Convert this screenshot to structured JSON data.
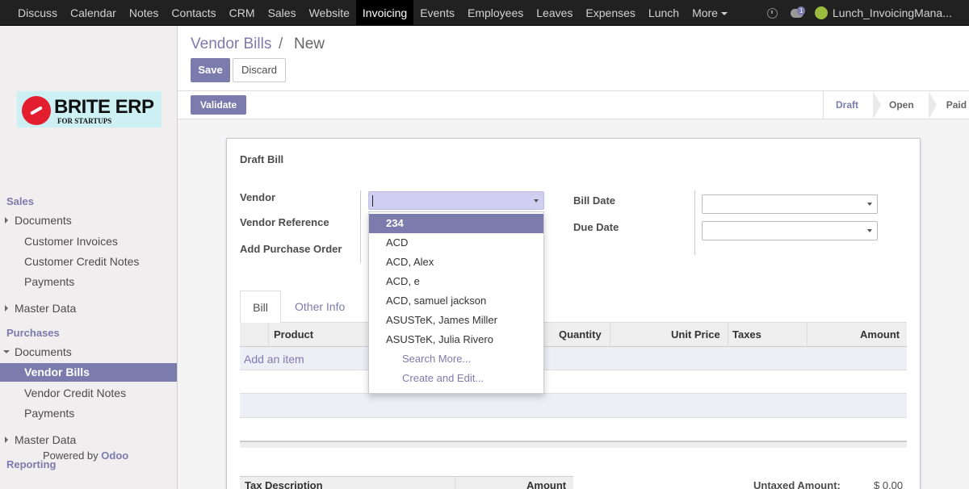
{
  "topmenu": {
    "items": [
      "Discuss",
      "Calendar",
      "Notes",
      "Contacts",
      "CRM",
      "Sales",
      "Website",
      "Invoicing",
      "Events",
      "Employees",
      "Leaves",
      "Expenses",
      "Lunch"
    ],
    "more_label": "More",
    "notification_count": "1",
    "user_name": "Lunch_InvoicingMana..."
  },
  "logo": {
    "name": "BRITE ERP",
    "tagline": "FOR STARTUPS"
  },
  "sidebar": {
    "sales_header": "Sales",
    "sales_documents": "Documents",
    "customer_invoices": "Customer Invoices",
    "customer_credit_notes": "Customer Credit Notes",
    "sales_payments": "Payments",
    "sales_master_data": "Master Data",
    "purchases_header": "Purchases",
    "purchases_documents": "Documents",
    "vendor_bills": "Vendor Bills",
    "vendor_credit_notes": "Vendor Credit Notes",
    "purchases_payments": "Payments",
    "purchases_master_data": "Master Data",
    "reporting_header": "Reporting",
    "powered_by": "Powered by",
    "powered_brand": "Odoo"
  },
  "breadcrumb": {
    "parent": "Vendor Bills",
    "separator": "/",
    "current": "New"
  },
  "buttons": {
    "save": "Save",
    "discard": "Discard",
    "validate": "Validate"
  },
  "status_stages": [
    "Draft",
    "Open",
    "Paid"
  ],
  "form": {
    "title": "Draft Bill",
    "vendor_label": "Vendor",
    "vendor_reference_label": "Vendor Reference",
    "add_purchase_order_label": "Add Purchase Order",
    "bill_date_label": "Bill Date",
    "due_date_label": "Due Date",
    "vendor_value": ""
  },
  "vendor_dropdown": {
    "options": [
      "234",
      "ACD",
      "ACD, Alex",
      "ACD, e",
      "ACD, samuel jackson",
      "ASUSTeK, James Miller",
      "ASUSTeK, Julia Rivero"
    ],
    "search_more": "Search More...",
    "create_and_edit": "Create and Edit..."
  },
  "tabs": {
    "bill": "Bill",
    "other_info": "Other Info"
  },
  "table": {
    "columns": {
      "product": "Product",
      "quantity": "Quantity",
      "unit_price": "Unit Price",
      "taxes": "Taxes",
      "amount": "Amount"
    },
    "add_item": "Add an item"
  },
  "tax_table": {
    "description": "Tax Description",
    "amount": "Amount"
  },
  "totals": {
    "untaxed_label": "Untaxed Amount:",
    "untaxed_value": "$ 0.00"
  },
  "colors": {
    "accent": "#7c7bad",
    "topbar": "#212121",
    "sidebar": "#f0eeee",
    "vendor_input": "#d0cff2"
  }
}
